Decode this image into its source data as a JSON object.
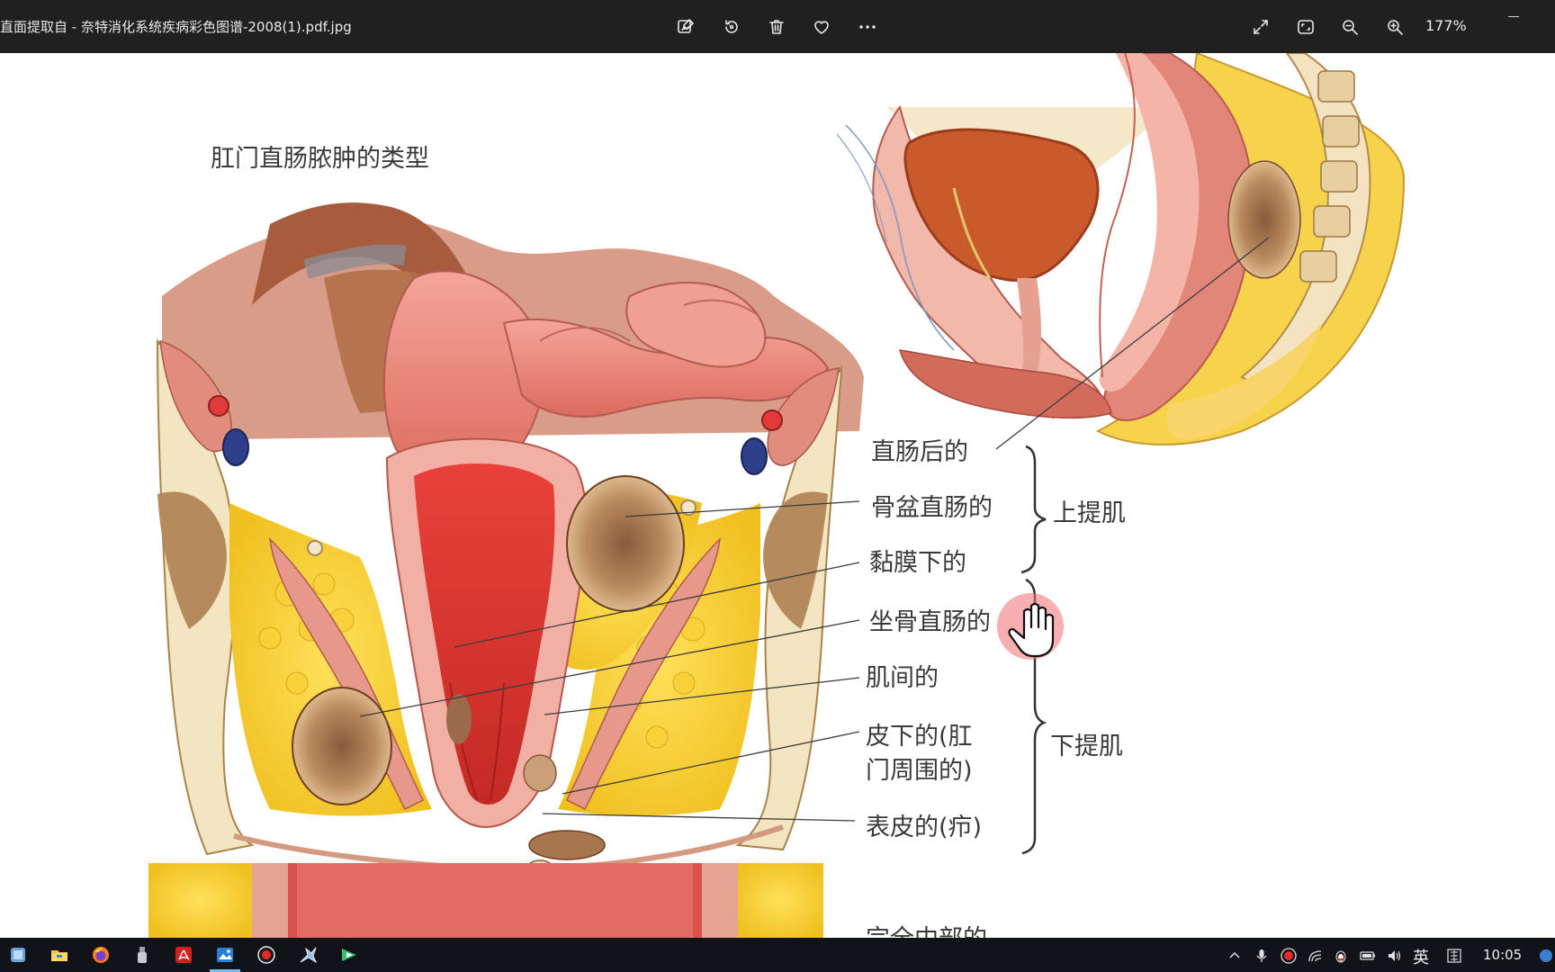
{
  "window": {
    "title": "直面提取自 - 奈特消化系统疾病彩色图谱-2008(1).pdf.jpg",
    "zoom_level": "177%"
  },
  "toolbar": {
    "buttons": [
      {
        "name": "edit-image-icon"
      },
      {
        "name": "rotate-icon"
      },
      {
        "name": "delete-icon"
      },
      {
        "name": "favorite-icon"
      },
      {
        "name": "more-icon"
      }
    ],
    "right_buttons": [
      {
        "name": "fullscreen-icon"
      },
      {
        "name": "fit-window-icon"
      },
      {
        "name": "zoom-out-icon"
      },
      {
        "name": "zoom-in-icon"
      }
    ]
  },
  "figure": {
    "heading": "肛门直肠脓肿的类型",
    "labels": {
      "retrorectal": "直肠后的",
      "pelvirectal": "骨盆直肠的",
      "submucosal": "黏膜下的",
      "ischiorectal": "坐骨直肠的",
      "intermuscular": "肌间的",
      "subcutaneous_1": "皮下的(肛",
      "subcutaneous_2": "门周围的)",
      "cutaneous": "表皮的(疖)",
      "supralevator": "上提肌",
      "infralevator": "下提肌",
      "cut_off_bottom": "完全中部的"
    }
  },
  "taskbar": {
    "apps": [
      "tablet-icon",
      "file-explorer-icon",
      "firefox-icon",
      "usb-icon",
      "acrobat-icon",
      "photos-icon",
      "record-icon",
      "tool-icon",
      "app-icon"
    ],
    "active_app": "photos-icon",
    "tray": {
      "ime_label": "英",
      "clock": "10:05"
    }
  }
}
